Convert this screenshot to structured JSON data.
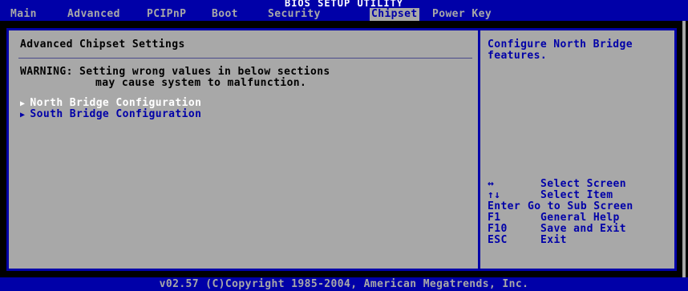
{
  "title": "BIOS SETUP UTILITY",
  "menu": {
    "main": "Main",
    "advanced": "Advanced",
    "pcipnp": "PCIPnP",
    "boot": "Boot",
    "security": "Security",
    "chipset": "Chipset",
    "power_key": "Power Key"
  },
  "left_panel": {
    "heading": "Advanced Chipset Settings",
    "warning_line1": "WARNING: Setting wrong values in below sections",
    "warning_line2": "may cause system to malfunction.",
    "items": [
      {
        "label": "North Bridge Configuration"
      },
      {
        "label": "South Bridge Configuration"
      }
    ]
  },
  "help": {
    "line1": "Configure North Bridge",
    "line2": "features."
  },
  "keys": [
    {
      "key": "↔",
      "action": "Select Screen"
    },
    {
      "key": "↑↓",
      "action": "Select Item"
    },
    {
      "key": "Enter",
      "action": "Go to Sub Screen"
    },
    {
      "key": "F1",
      "action": "General Help"
    },
    {
      "key": "F10",
      "action": "Save and Exit"
    },
    {
      "key": "ESC",
      "action": "Exit"
    }
  ],
  "footer": "v02.57 (C)Copyright 1985-2004, American Megatrends, Inc.",
  "colors": {
    "background_blue": "#0000a8",
    "panel_gray": "#a8a8a8",
    "highlight_white": "#ffffff"
  },
  "icons": {
    "submenu_arrow": "submenu-arrow-icon"
  }
}
